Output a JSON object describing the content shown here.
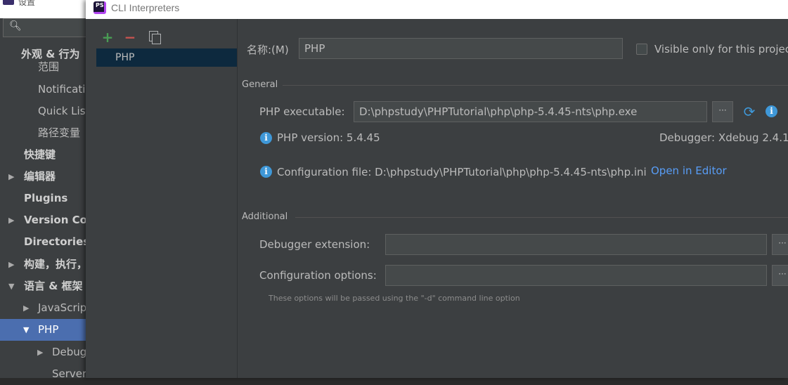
{
  "settings": {
    "title": "设置",
    "tree": [
      {
        "label": "外观 & 行为",
        "bold": true,
        "arrow": ""
      },
      {
        "label": "范围",
        "bold": false,
        "arrow": ""
      },
      {
        "label": "Notifications",
        "bold": false,
        "arrow": ""
      },
      {
        "label": "Quick Lists",
        "bold": false,
        "arrow": ""
      },
      {
        "label": "路径变量",
        "bold": false,
        "arrow": ""
      },
      {
        "label": "快捷键",
        "bold": true,
        "arrow": ""
      },
      {
        "label": "编辑器",
        "bold": true,
        "arrow": "▶"
      },
      {
        "label": "Plugins",
        "bold": true,
        "arrow": ""
      },
      {
        "label": "Version Control",
        "bold": true,
        "arrow": "▶"
      },
      {
        "label": "Directories",
        "bold": true,
        "arrow": ""
      },
      {
        "label": "构建，执行，部署",
        "bold": true,
        "arrow": "▶"
      },
      {
        "label": "语言 & 框架",
        "bold": true,
        "arrow": "▼"
      },
      {
        "label": "JavaScript",
        "bold": false,
        "arrow": "▶"
      },
      {
        "label": "PHP",
        "bold": false,
        "arrow": "▼"
      },
      {
        "label": "Debug",
        "bold": false,
        "arrow": "▶"
      },
      {
        "label": "Servers",
        "bold": false,
        "arrow": ""
      }
    ]
  },
  "dialog": {
    "title": "CLI Interpreters",
    "app_icon_text": "PS",
    "toolbar": {
      "add_label": "+",
      "remove_label": "−"
    },
    "interpreters": [
      {
        "name": "PHP"
      }
    ],
    "name_label": "名称:(M)",
    "name_value": "PHP",
    "visible_only_label": "Visible only for this project",
    "general": {
      "section_label": "General",
      "executable_label": "PHP executable:",
      "executable_value": "D:\\phpstudy\\PHPTutorial\\php\\php-5.4.45-nts\\php.exe",
      "browse_label": "···",
      "php_version_label": "PHP version: 5.4.45",
      "debugger_label": "Debugger:",
      "debugger_value": "Xdebug 2.4.1",
      "config_file_label": "Configuration file: D:\\phpstudy\\PHPTutorial\\php\\php-5.4.45-nts\\php.ini",
      "open_in_editor_label": "Open in Editor"
    },
    "additional": {
      "section_label": "Additional",
      "debugger_ext_label": "Debugger extension:",
      "debugger_ext_value": "",
      "config_options_label": "Configuration options:",
      "config_options_value": "",
      "browse_label": "···",
      "hint": "These options will be passed using the \"-d\" command line option"
    }
  },
  "colors": {
    "panel": "#3c3f41",
    "selection": "#4b6eaf",
    "list_selection": "#0d293e",
    "link": "#589df6",
    "info": "#3f98d8"
  }
}
